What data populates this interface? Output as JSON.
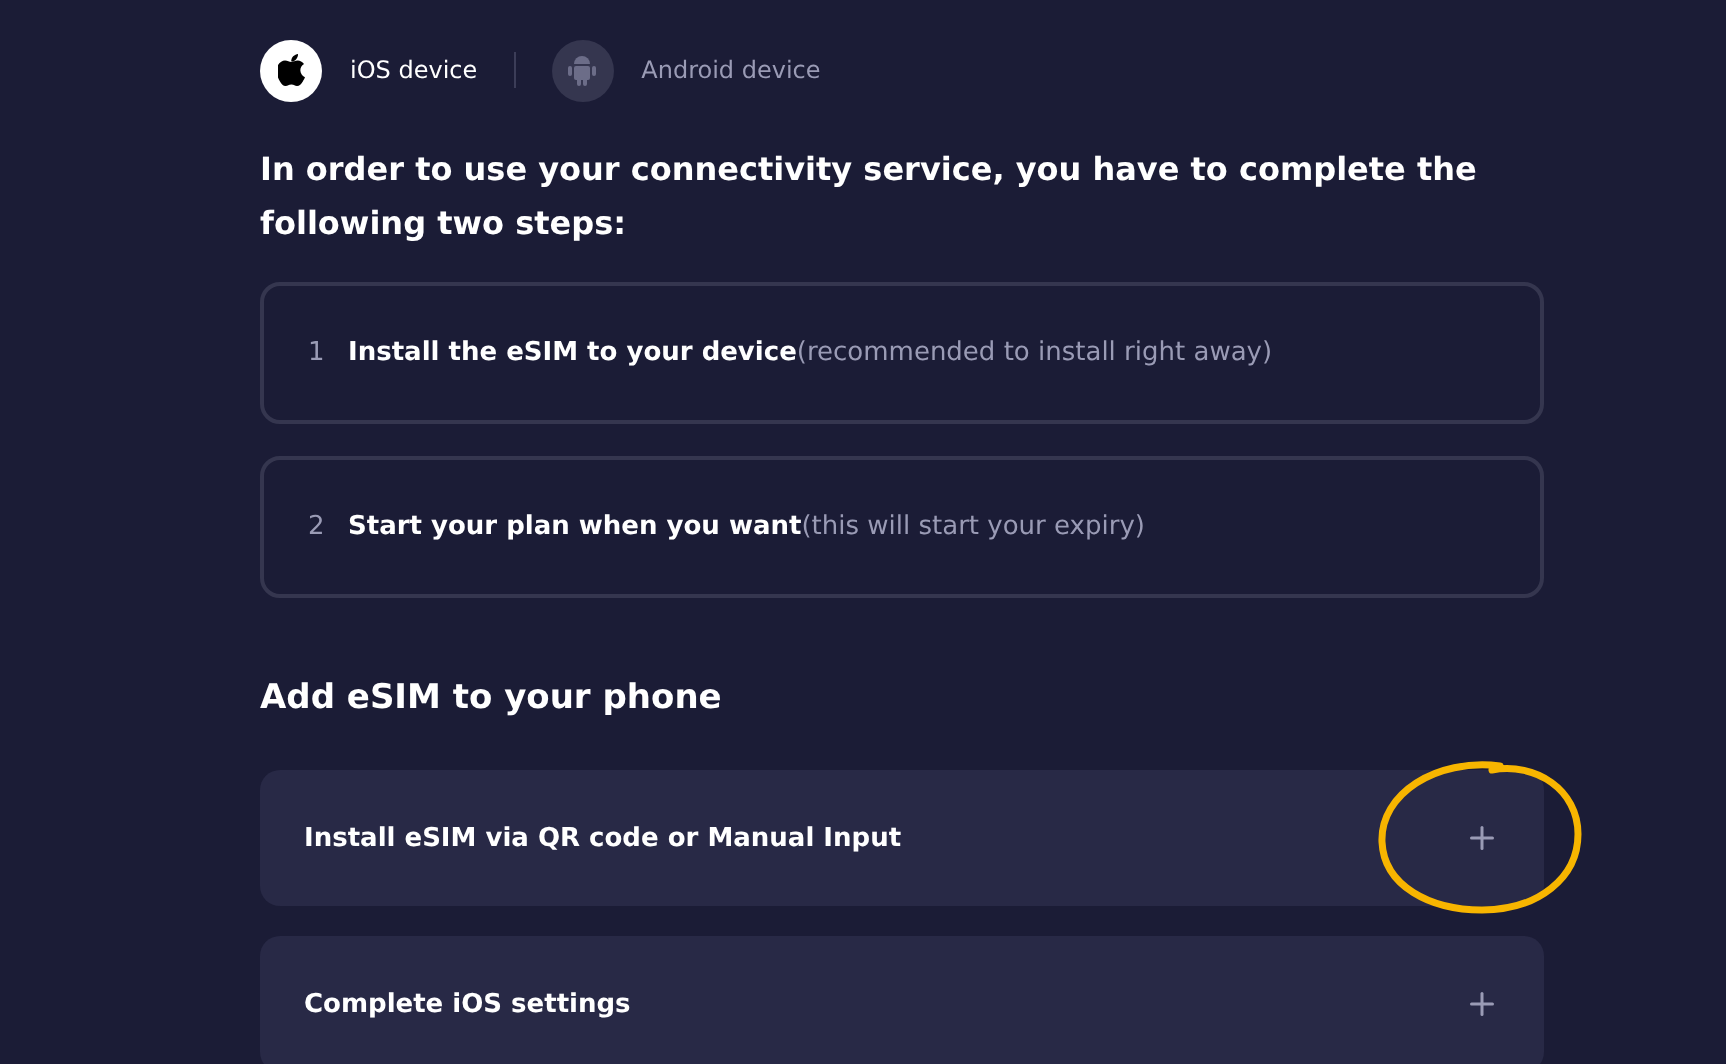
{
  "device_tabs": [
    {
      "label": "iOS device",
      "kind": "apple",
      "selected": true
    },
    {
      "label": "Android device",
      "kind": "android",
      "selected": false
    }
  ],
  "intro": "In order to use your connectivity service, you have to complete the following two steps:",
  "steps": [
    {
      "number": "1",
      "title": "Install the eSIM to your device",
      "note": "(recommended to install right away)"
    },
    {
      "number": "2",
      "title": "Start your plan when you want",
      "note": "(this will start your expiry)"
    }
  ],
  "section_title": "Add eSIM to your phone",
  "accordion": [
    {
      "label": "Install eSIM via QR code or Manual Input",
      "expanded": false,
      "circled": true
    },
    {
      "label": "Complete iOS settings",
      "expanded": false,
      "circled": false
    }
  ]
}
